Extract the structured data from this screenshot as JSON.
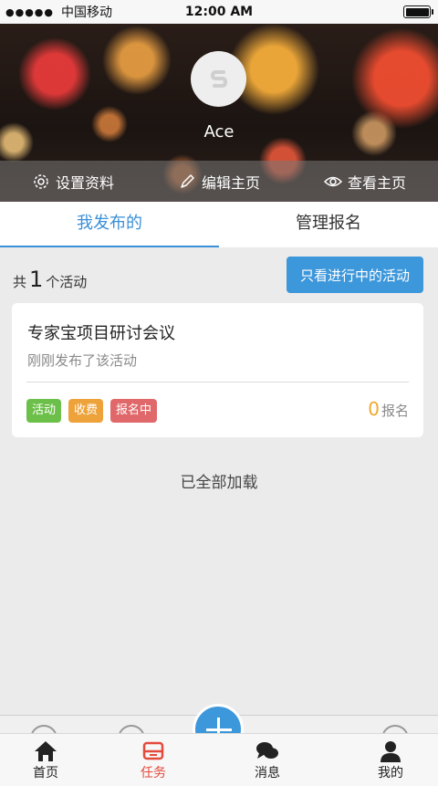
{
  "status_bar": {
    "signal": "●●●●●",
    "carrier": "中国移动",
    "time": "12:00 AM"
  },
  "profile": {
    "username": "Ace",
    "actions": [
      {
        "label": "设置资料",
        "icon": "gear-icon"
      },
      {
        "label": "编辑主页",
        "icon": "pen-icon"
      },
      {
        "label": "查看主页",
        "icon": "eye-icon"
      }
    ]
  },
  "tabs": [
    {
      "label": "我发布的",
      "active": true
    },
    {
      "label": "管理报名",
      "active": false
    }
  ],
  "summary": {
    "prefix": "共",
    "count": "1",
    "suffix": "个活动"
  },
  "filter_button": "只看进行中的活动",
  "activity": {
    "title": "专家宝项目研讨会议",
    "status_text": "刚刚发布了该活动",
    "tags": [
      {
        "label": "活动",
        "color": "#6cc04a"
      },
      {
        "label": "收费",
        "color": "#eea23a"
      },
      {
        "label": "报名中",
        "color": "#e0686a"
      }
    ],
    "signup_count": "0",
    "signup_label": "报名"
  },
  "load_status": "已全部加载",
  "tabbar": [
    {
      "label": "首页",
      "icon": "home-icon",
      "active": false
    },
    {
      "label": "任务",
      "icon": "task-icon",
      "active": true
    },
    {
      "label": "消息",
      "icon": "message-icon",
      "active": false
    },
    {
      "label": "我的",
      "icon": "user-icon",
      "active": false
    }
  ],
  "colors": {
    "accent": "#3d97db",
    "active_tab": "#e44a3c"
  }
}
